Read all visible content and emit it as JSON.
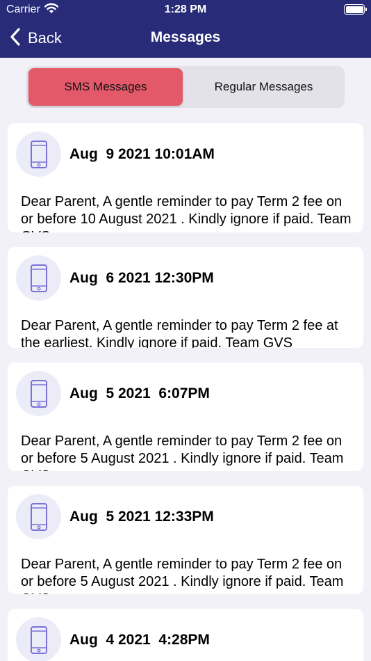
{
  "status_bar": {
    "carrier": "Carrier",
    "time": "1:28 PM"
  },
  "nav": {
    "back_label": "Back",
    "title": "Messages"
  },
  "tabs": [
    {
      "label": "SMS Messages",
      "selected": true
    },
    {
      "label": "Regular Messages",
      "selected": false
    }
  ],
  "messages": [
    {
      "date": "Aug  9 2021 10:01AM",
      "body": "Dear Parent, A gentle reminder to pay Term 2 fee on or before 10 August 2021 . Kindly ignore if paid. Team GVS"
    },
    {
      "date": "Aug  6 2021 12:30PM",
      "body": "Dear Parent, A gentle reminder to pay Term 2 fee at the earliest. Kindly ignore if paid. Team GVS"
    },
    {
      "date": "Aug  5 2021  6:07PM",
      "body": "Dear Parent, A gentle reminder to pay Term 2 fee on or before 5 August 2021 . Kindly ignore if paid. Team GVS"
    },
    {
      "date": "Aug  5 2021 12:33PM",
      "body": "Dear Parent, A gentle reminder to pay Term 2 fee on or before 5 August 2021 . Kindly ignore if paid. Team GVS"
    },
    {
      "date": "Aug  4 2021  4:28PM",
      "body": ""
    }
  ],
  "colors": {
    "nav_bg": "#272b78",
    "active_tab": "#e3596a",
    "icon_bg": "#ecebf8",
    "icon_stroke": "#7b72d6"
  },
  "icons": {
    "message_icon": "phone-icon",
    "back_icon": "chevron-left-icon"
  }
}
